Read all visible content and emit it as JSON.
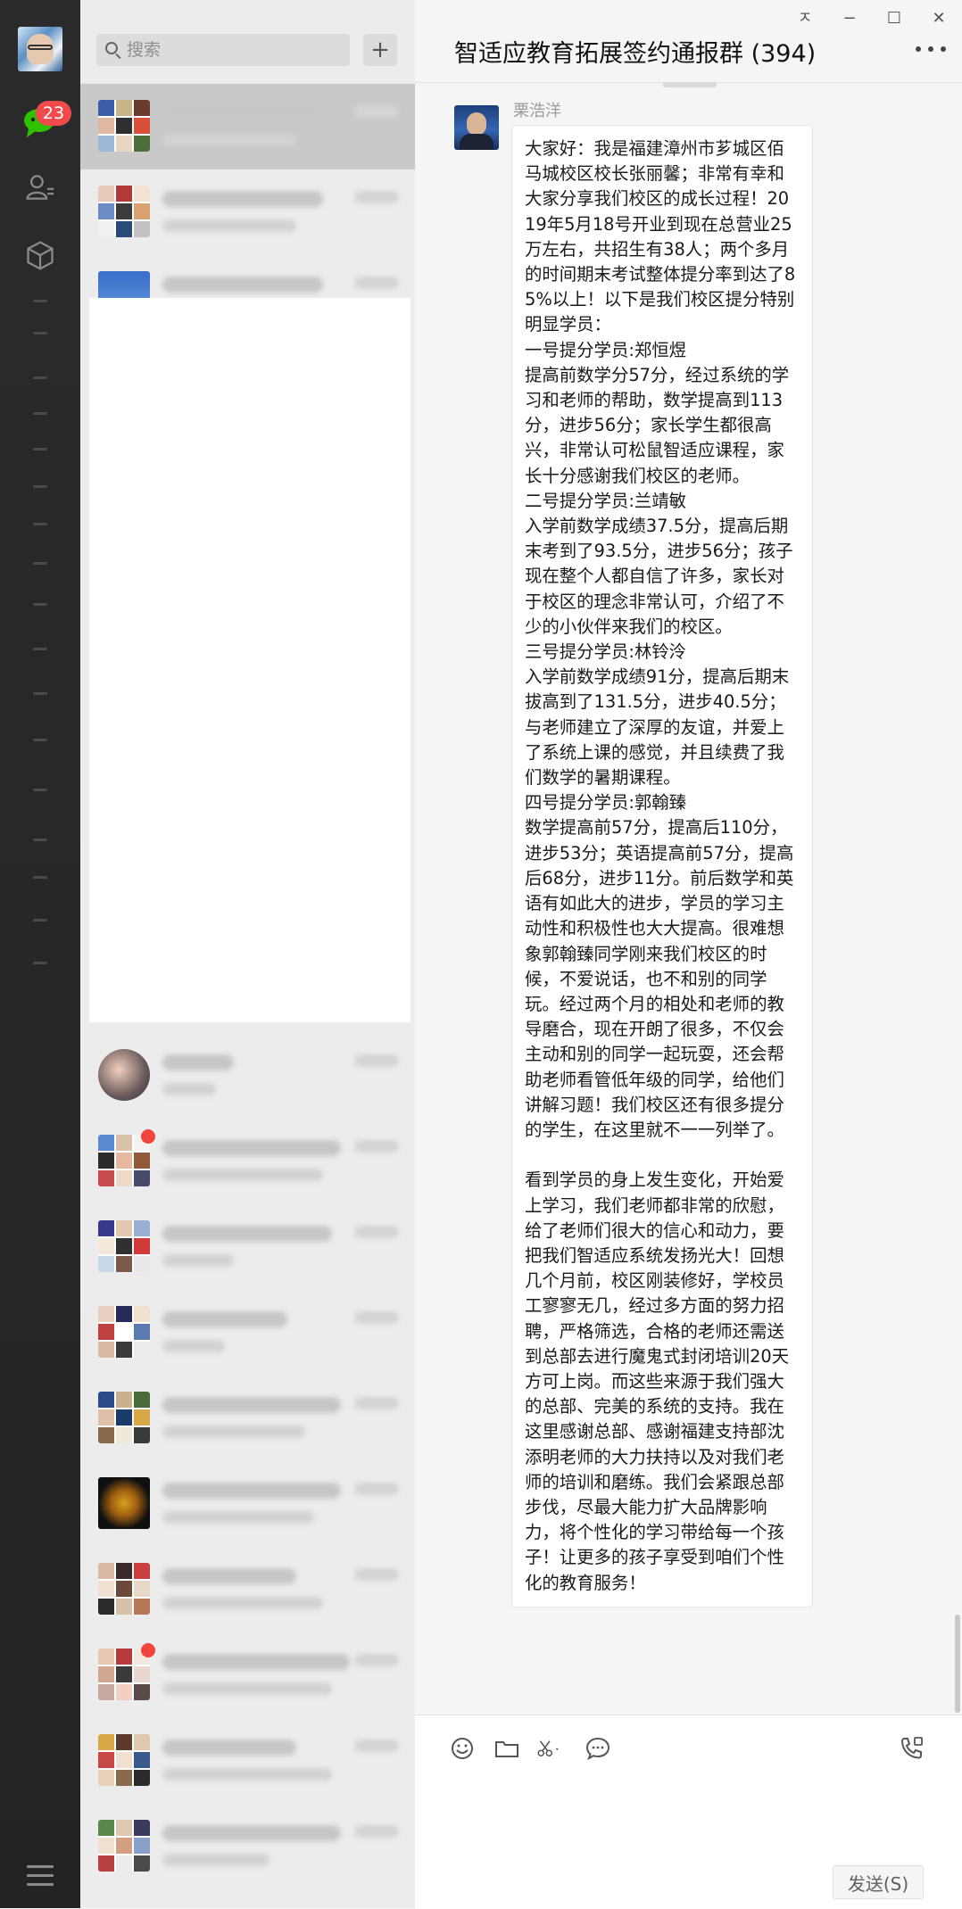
{
  "nav": {
    "unread_badge": "23",
    "accent_color": "#2dc100",
    "badge_color": "#f24a4a",
    "icons": [
      "chat-icon",
      "contacts-icon",
      "favorites-icon",
      "menu-icon"
    ]
  },
  "search": {
    "placeholder": "搜索",
    "add_label": "+"
  },
  "window": {
    "title": "智适应教育拓展签约通报群 (394)",
    "pin_label": "ㅈ",
    "minimize_label": "−",
    "maximize_label": "☐",
    "close_label": "✕"
  },
  "message": {
    "sender": "栗浩洋",
    "text": "大家好：我是福建漳州市芗城区佰马城校区校长张丽馨；非常有幸和大家分享我们校区的成长过程！2019年5月18号开业到现在总营业25万左右，共招生有38人；两个多月的时间期末考试整体提分率到达了85%以上！以下是我们校区提分特别明显学员：\n一号提分学员:郑恒煜\n提高前数学分57分，经过系统的学习和老师的帮助，数学提高到113分，进步56分；家长学生都很高兴，非常认可松鼠智适应课程，家长十分感谢我们校区的老师。\n二号提分学员:兰靖敏\n入学前数学成绩37.5分，提高后期末考到了93.5分，进步56分；孩子现在整个人都自信了许多，家长对于校区的理念非常认可，介绍了不少的小伙伴来我们的校区。\n三号提分学员:林铃泠\n入学前数学成绩91分，提高后期末拔高到了131.5分，进步40.5分；与老师建立了深厚的友谊，并爱上了系统上课的感觉，并且续费了我们数学的暑期课程。\n四号提分学员:郭翰臻\n数学提高前57分，提高后110分，进步53分；英语提高前57分，提高后68分，进步11分。前后数学和英语有如此大的进步，学员的学习主动性和积极性也大大提高。很难想象郭翰臻同学刚来我们校区的时候，不爱说话，也不和别的同学玩。经过两个月的相处和老师的教导磨合，现在开朗了很多，不仅会主动和别的同学一起玩耍，还会帮助老师看管低年级的同学，给他们讲解习题！我们校区还有很多提分的学生，在这里就不一一列举了。\n\n看到学员的身上发生变化，开始爱上学习，我们老师都非常的欣慰，给了老师们很大的信心和动力，要把我们智适应系统发扬光大！回想几个月前，校区刚装修好，学校员工寥寥无几，经过多方面的努力招聘，严格筛选，合格的老师还需送到总部去进行魔鬼式封闭培训20天方可上岗。而这些来源于我们强大的总部、完美的系统的支持。我在这里感谢总部、感谢福建支持部沈添明老师的大力扶持以及对我们老师的培训和磨练。我们会紧跟总部步伐，尽最大能力扩大品牌影响力，将个性化的学习带给每一个孩子！让更多的孩子享受到咱们个性化的教育服务！"
  },
  "toolbar": {
    "icons": [
      "emoji-icon",
      "folder-icon",
      "scissors-icon",
      "chat-history-icon",
      "call-icon"
    ],
    "send_label": "发送(S)"
  }
}
